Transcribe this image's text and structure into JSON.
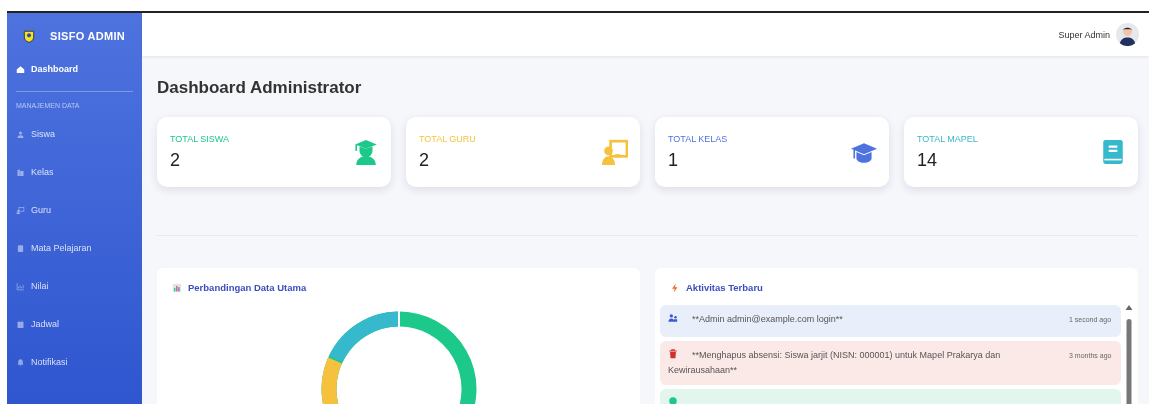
{
  "sidebar": {
    "brand": "SISFO ADMIN",
    "primary": [
      {
        "label": "Dashboard",
        "selected": true
      }
    ],
    "section": "MANAJEMEN DATA",
    "items": [
      {
        "label": "Siswa",
        "selected": false
      },
      {
        "label": "Kelas",
        "selected": false
      },
      {
        "label": "Guru",
        "selected": false
      },
      {
        "label": "Mata Pelajaran",
        "selected": false
      },
      {
        "label": "Nilai",
        "selected": false
      },
      {
        "label": "Jadwal",
        "selected": false
      },
      {
        "label": "Notifikasi",
        "selected": false
      }
    ]
  },
  "header": {
    "user": "Super Admin"
  },
  "page_title": "Dashboard Administrator",
  "stats": [
    {
      "label": "TOTAL SISWA",
      "value": "2",
      "color": "#1cc88a"
    },
    {
      "label": "TOTAL GURU",
      "value": "2",
      "color": "#f6c23e"
    },
    {
      "label": "TOTAL KELAS",
      "value": "1",
      "color": "#4e73df"
    },
    {
      "label": "TOTAL MAPEL",
      "value": "14",
      "color": "#36b9cc"
    }
  ],
  "chart_panel": {
    "title": "Perbandingan Data Utama"
  },
  "activity_panel": {
    "title": "Aktivitas Terbaru",
    "items": [
      {
        "kind": "login",
        "text": "**Admin admin@example.com login**",
        "time": "1 second ago"
      },
      {
        "kind": "delete",
        "text": "**Menghapus absensi: Siswa jarjit (NISN: 000001) untuk Mapel Prakarya dan Kewirausahaan**",
        "time": "3 months ago"
      },
      {
        "kind": "create"
      }
    ]
  }
}
